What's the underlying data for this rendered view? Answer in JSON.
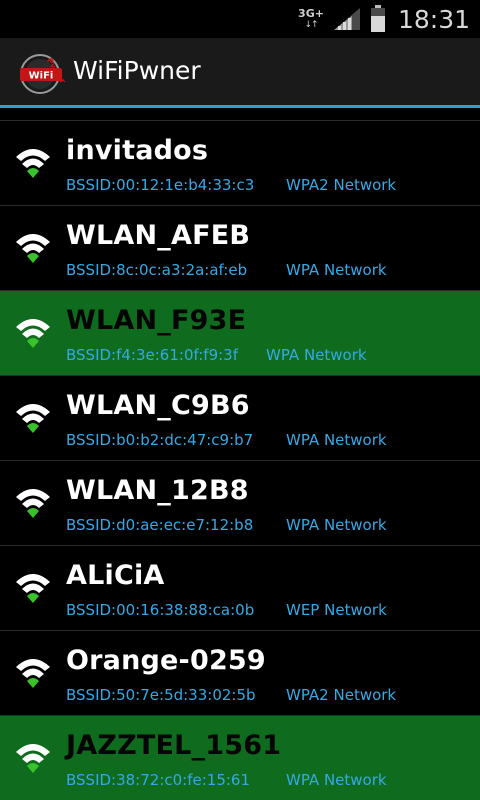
{
  "status_bar": {
    "network_type": "3G+",
    "network_arrows": "↓↑",
    "time": "18:31"
  },
  "app": {
    "title": "WiFiPwner",
    "logo_text": "WiFi",
    "logo_banner": "Pwner"
  },
  "networks": [
    {
      "ssid": "invitados",
      "bssid": "BSSID:00:12:1e:b4:33:c3",
      "security": "WPA2 Network",
      "highlighted": false
    },
    {
      "ssid": "WLAN_AFEB",
      "bssid": "BSSID:8c:0c:a3:2a:af:eb",
      "security": "WPA Network",
      "highlighted": false
    },
    {
      "ssid": "WLAN_F93E",
      "bssid": "BSSID:f4:3e:61:0f:f9:3f",
      "security": "WPA Network",
      "highlighted": true
    },
    {
      "ssid": "WLAN_C9B6",
      "bssid": "BSSID:b0:b2:dc:47:c9:b7",
      "security": "WPA Network",
      "highlighted": false
    },
    {
      "ssid": "WLAN_12B8",
      "bssid": "BSSID:d0:ae:ec:e7:12:b8",
      "security": "WPA Network",
      "highlighted": false
    },
    {
      "ssid": "ALiCiA",
      "bssid": "BSSID:00:16:38:88:ca:0b",
      "security": "WEP Network",
      "highlighted": false
    },
    {
      "ssid": "Orange-0259",
      "bssid": "BSSID:50:7e:5d:33:02:5b",
      "security": "WPA2 Network",
      "highlighted": false
    },
    {
      "ssid": "JAZZTEL_1561",
      "bssid": "BSSID:38:72:c0:fe:15:61",
      "security": "WPA Network",
      "highlighted": true
    }
  ],
  "colors": {
    "accent": "#2e9fd6",
    "highlight_row": "#0f6b1e",
    "link_text": "#35a9e6",
    "wifi_green": "#39c22b"
  }
}
